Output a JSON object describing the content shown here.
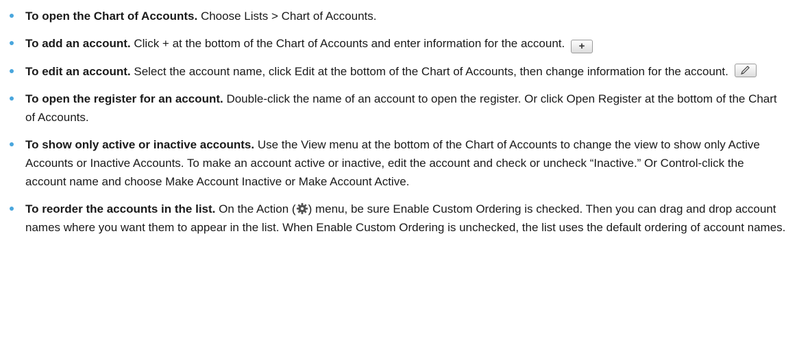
{
  "items": [
    {
      "lead": "To open the Chart of Accounts.",
      "body": " Choose Lists > Chart of Accounts."
    },
    {
      "lead": "To add an account.",
      "body": " Click + at the bottom of the Chart of Accounts and enter information for the account.",
      "button_label": "+"
    },
    {
      "lead": "To edit an account.",
      "body": " Select the account name, click Edit at the bottom of the Chart of Accounts, then change information for the account."
    },
    {
      "lead": "To open the register for an account.",
      "body": " Double-click the name of an account to open the register. Or click Open Register at the bottom of the Chart of Accounts."
    },
    {
      "lead": "To show only active or inactive accounts.",
      "body": " Use the View menu at the bottom of the Chart of Accounts to change the view to show only Active Accounts or Inactive Accounts. To make an account active or inactive, edit the account and check or uncheck “Inactive.” Or Control-click the account name and choose Make Account Inactive or Make Account Active."
    },
    {
      "lead": "To reorder the accounts in the list.",
      "body_before_icon": " On the Action (",
      "body_after_icon": ") menu, be sure Enable Custom Ordering is checked. Then you can drag and drop account names where you want them to appear in the list. When Enable Custom Ordering is unchecked, the list uses the default ordering of account names."
    }
  ],
  "icons": {
    "add_button": "plus-icon",
    "edit_button": "pencil-icon",
    "action_menu": "gear-icon"
  },
  "colors": {
    "bullet": "#49a6dd",
    "text": "#1a1a1a"
  }
}
